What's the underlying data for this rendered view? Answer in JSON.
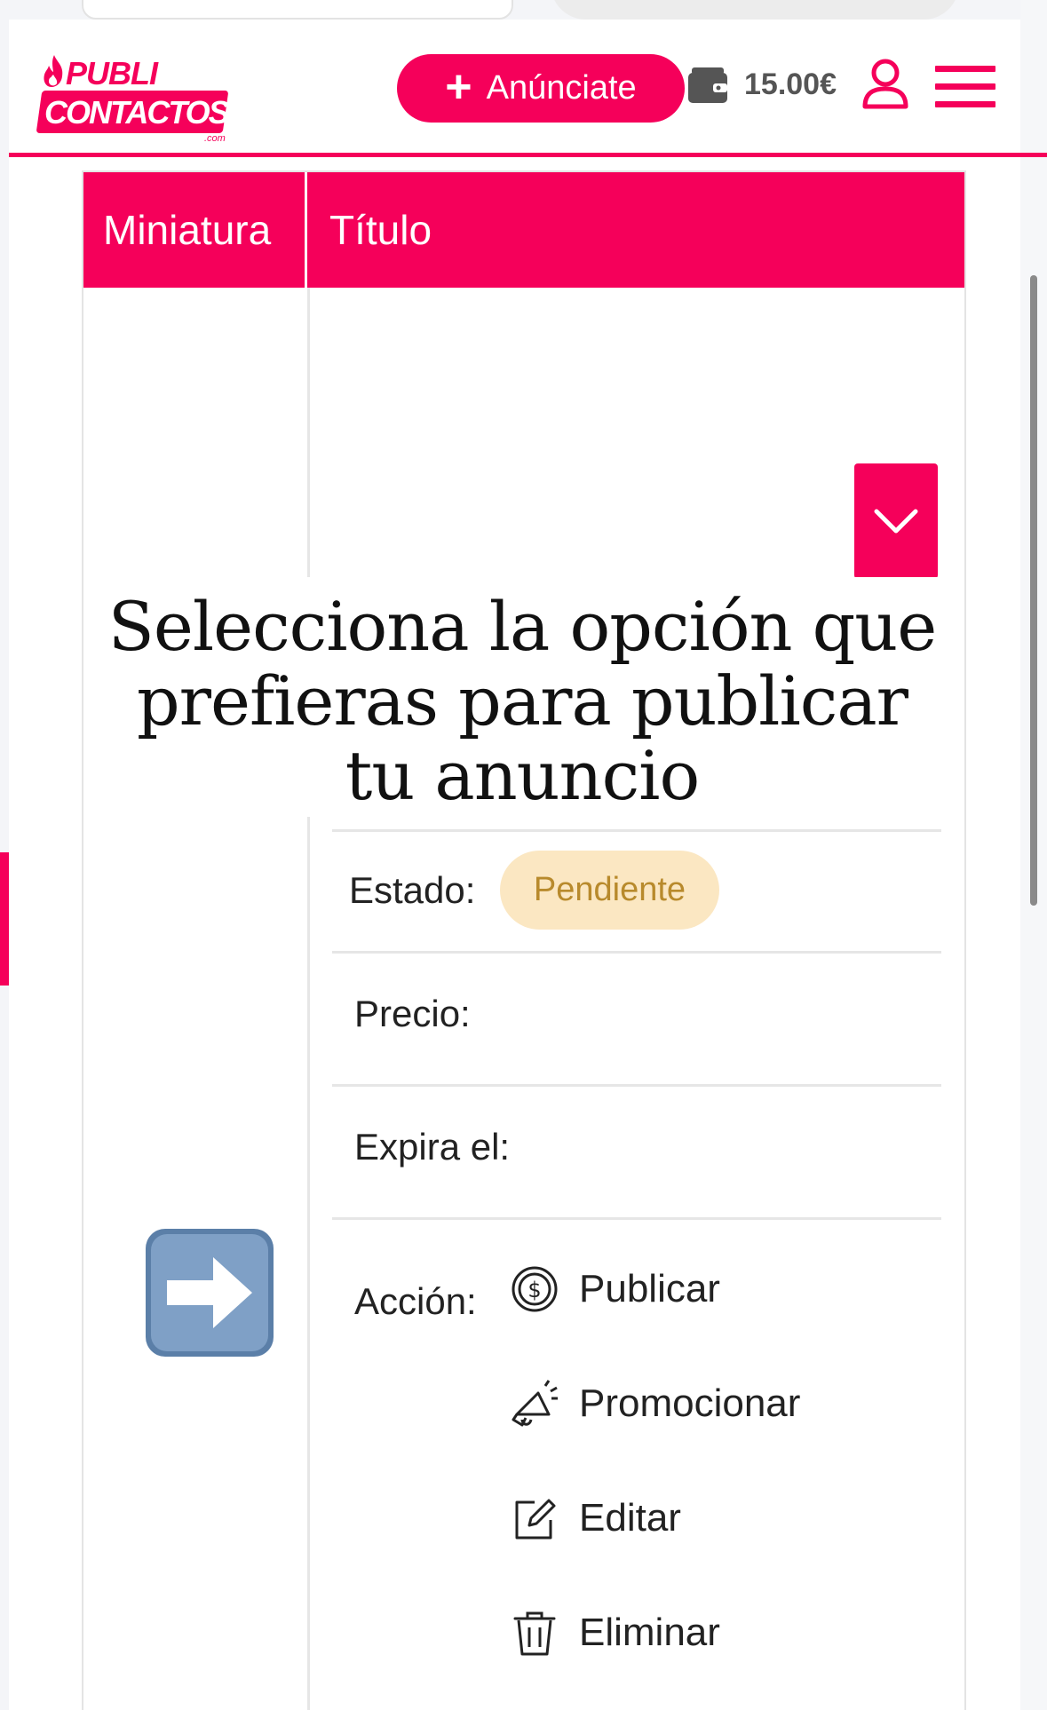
{
  "header": {
    "logo_top": "PUBLI",
    "logo_bottom": "CONTACTOS",
    "logo_suffix": ".com",
    "cta_label": "Anúnciate",
    "balance": "15.00€",
    "icons": {
      "cta": "plus-icon",
      "wallet": "wallet-icon",
      "user": "user-icon",
      "menu": "hamburger-menu-icon"
    }
  },
  "colors": {
    "brand": "#f5005a",
    "status_bg": "#fbe7c2",
    "status_text": "#b88a2c"
  },
  "table": {
    "columns": [
      "Miniatura",
      "Título"
    ]
  },
  "overlay": {
    "title": "Selecciona la opción que prefieras para publicar tu anuncio"
  },
  "details": {
    "status_label": "Estado:",
    "status_value": "Pendiente",
    "price_label": "Precio:",
    "expires_label": "Expira el:",
    "action_label": "Acción:"
  },
  "actions": [
    {
      "label": "Publicar",
      "icon": "dollar-coin-icon"
    },
    {
      "label": "Promocionar",
      "icon": "megaphone-icon"
    },
    {
      "label": "Editar",
      "icon": "edit-icon"
    },
    {
      "label": "Eliminar",
      "icon": "trash-icon"
    }
  ],
  "decor": {
    "left_column_icon": "right-arrow-emoji-icon",
    "toggle_icon": "chevron-down-icon"
  }
}
